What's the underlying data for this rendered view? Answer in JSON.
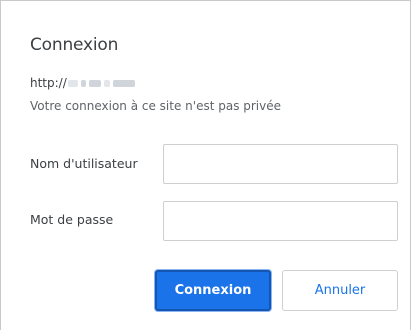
{
  "dialog": {
    "title": "Connexion",
    "url_prefix": "http://",
    "subtitle": "Votre connexion à ce site n'est pas privée",
    "username_label": "Nom d'utilisateur",
    "username_value": "",
    "password_label": "Mot de passe",
    "password_value": "",
    "submit_label": "Connexion",
    "cancel_label": "Annuler"
  },
  "colors": {
    "primary": "#1a73e8",
    "border": "#cfcfcf"
  }
}
